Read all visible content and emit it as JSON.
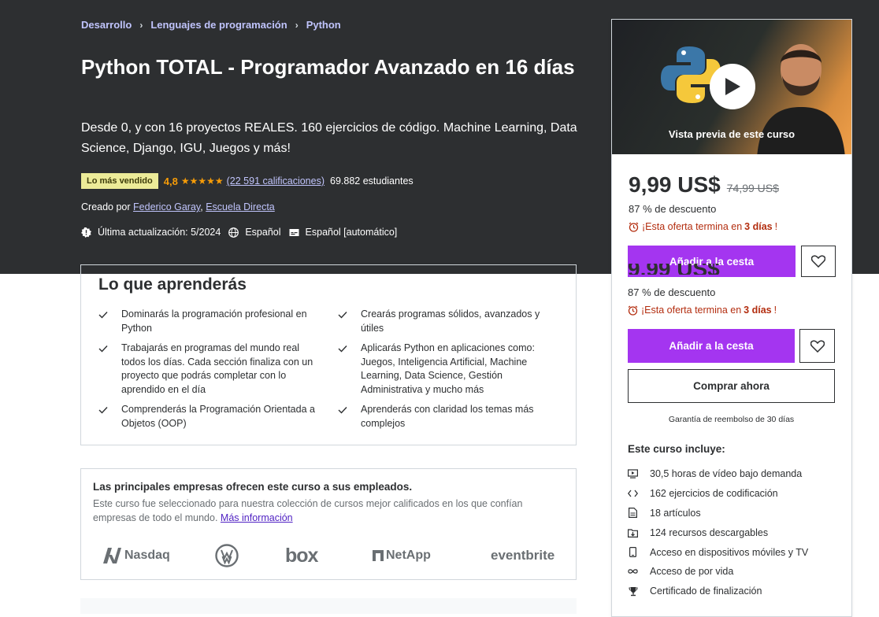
{
  "breadcrumb": [
    "Desarrollo",
    "Lenguajes de programación",
    "Python"
  ],
  "course": {
    "title": "Python TOTAL - Programador Avanzado en 16 días",
    "subtitle": "Desde 0, y con 16 proyectos REALES. 160 ejercicios de código. Machine Learning, Data Science, Django, IGU, Juegos y más!",
    "badge": "Lo más vendido",
    "rating": "4,8",
    "stars": "★★★★★",
    "ratings_count": "(22 591 calificaciones)",
    "students": "69.882 estudiantes",
    "created_label": "Creado por",
    "authors": [
      "Federico Garay",
      "Escuela Directa"
    ],
    "updated": "Última actualización: 5/2024",
    "language": "Español",
    "captions": "Español [automático]"
  },
  "sidebar": {
    "preview_label": "Vista previa de este curso",
    "price": "9,99 US$",
    "old_price": "74,99 US$",
    "discount": "87 % de descuento",
    "offer_prefix": "¡Esta oferta termina en",
    "offer_days": "3 días",
    "offer_suffix": "!",
    "add_to_cart": "Añadir a la cesta",
    "buy_now": "Comprar ahora",
    "guarantee": "Garantía de reembolso de 30 días",
    "includes_title": "Este curso incluye:",
    "includes": [
      {
        "icon": "video-icon",
        "text": "30,5 horas de vídeo bajo demanda"
      },
      {
        "icon": "code-icon",
        "text": "162 ejercicios de codificación"
      },
      {
        "icon": "article-icon",
        "text": "18 artículos"
      },
      {
        "icon": "download-icon",
        "text": "124 recursos descargables"
      },
      {
        "icon": "mobile-icon",
        "text": "Acceso en dispositivos móviles y TV"
      },
      {
        "icon": "infinity-icon",
        "text": "Acceso de por vida"
      },
      {
        "icon": "trophy-icon",
        "text": "Certificado de finalización"
      }
    ]
  },
  "learn": {
    "title": "Lo que aprenderás",
    "items": [
      "Dominarás la programación profesional en Python",
      "Crearás programas sólidos, avanzados y útiles",
      "Trabajarás en programas del mundo real todos los días. Cada sección finaliza con un proyecto que podrás completar con lo aprendido en el día",
      "Aplicarás Python en aplicaciones como: Juegos, Inteligencia Artificial, Machine Learning, Data Science, Gestión Administrativa y mucho más",
      "Comprenderás la Programación Orientada a Objetos (OOP)",
      "Aprenderás con claridad los temas más complejos"
    ]
  },
  "companies": {
    "title": "Las principales empresas ofrecen este curso a sus empleados.",
    "desc": "Este curso fue seleccionado para nuestra colección de cursos mejor calificados en los que confían empresas de todo el mundo.",
    "link": "Más información",
    "logos": [
      "Nasdaq",
      "box",
      "NetApp",
      "eventbrite"
    ]
  },
  "colors": {
    "hero_bg": "#2d2f31",
    "accent_purple": "#a435f0",
    "link_lavender": "#c0c4fc",
    "rating_orange": "#f69c08",
    "offer_red": "#b32d0f",
    "badge_yellow": "#eceb98"
  }
}
